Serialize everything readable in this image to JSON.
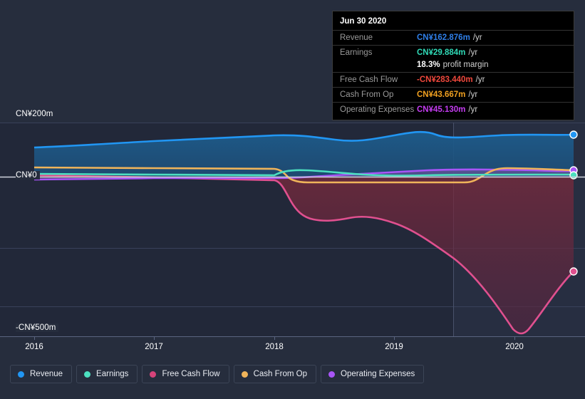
{
  "chart_data": {
    "type": "area",
    "title": "",
    "xlabel": "",
    "ylabel": "",
    "currency": "CN¥",
    "x_tick_labels": [
      "2016",
      "2017",
      "2018",
      "2019",
      "2020"
    ],
    "y_tick_labels": [
      "CN¥200m",
      "CN¥0",
      "-CN¥500m"
    ],
    "ylim": [
      -500,
      200
    ],
    "grid": true,
    "legend_position": "bottom-left",
    "series": [
      {
        "name": "Revenue",
        "color": "#2196f3",
        "x": [
          2016.0,
          2016.5,
          2017.0,
          2017.5,
          2018.0,
          2018.5,
          2019.0,
          2019.25,
          2019.5,
          2020.0,
          2020.5
        ],
        "values": [
          108,
          112,
          118,
          124,
          128,
          130,
          140,
          150,
          152,
          150,
          155
        ]
      },
      {
        "name": "Earnings",
        "color": "#4ce0c0",
        "x": [
          2016.0,
          2016.5,
          2017.0,
          2017.5,
          2018.0,
          2018.5,
          2019.0,
          2019.5,
          2020.0,
          2020.5
        ],
        "values": [
          12,
          12,
          11,
          10,
          24,
          20,
          14,
          14,
          18,
          22
        ]
      },
      {
        "name": "Free Cash Flow",
        "color": "#e0508f",
        "x": [
          2016.0,
          2016.5,
          2017.0,
          2017.5,
          2018.0,
          2018.25,
          2018.5,
          2019.0,
          2019.5,
          2020.0,
          2020.25,
          2020.5
        ],
        "values": [
          8,
          6,
          4,
          2,
          -10,
          -120,
          -150,
          -140,
          -230,
          -420,
          -580,
          -350
        ]
      },
      {
        "name": "Cash From Op",
        "color": "#f0b45a",
        "x": [
          2016.0,
          2016.5,
          2017.0,
          2017.5,
          2018.0,
          2018.25,
          2018.5,
          2019.0,
          2019.5,
          2019.9,
          2020.2,
          2020.5
        ],
        "values": [
          34,
          34,
          33,
          33,
          32,
          5,
          -3,
          -3,
          -3,
          -3,
          20,
          30
        ]
      },
      {
        "name": "Operating Expenses",
        "color": "#a855f7",
        "x": [
          2016.0,
          2016.5,
          2017.0,
          2017.5,
          2018.0,
          2018.5,
          2019.0,
          2019.5,
          2020.0,
          2020.5
        ],
        "values": [
          -10,
          -8,
          -6,
          -4,
          4,
          10,
          18,
          26,
          24,
          22
        ]
      }
    ],
    "endpoint_markers": [
      {
        "series": "Revenue",
        "color": "#2196f3"
      },
      {
        "series": "Operating Expenses",
        "color": "#a855f7"
      },
      {
        "series": "Earnings",
        "color": "#4ce0c0"
      },
      {
        "series": "Free Cash Flow",
        "color": "#e0508f"
      }
    ]
  },
  "axis": {
    "y_200m": "CN¥200m",
    "y_0": "CN¥0",
    "y_minus500m": "-CN¥500m",
    "x": [
      {
        "label": "2016"
      },
      {
        "label": "2017"
      },
      {
        "label": "2018"
      },
      {
        "label": "2019"
      },
      {
        "label": "2020"
      }
    ]
  },
  "tooltip": {
    "date": "Jun 30 2020",
    "rows": [
      {
        "label": "Revenue",
        "value": "CN¥162.876m",
        "unit": "/yr",
        "color": "#2f7fe8"
      },
      {
        "label": "Earnings",
        "value": "CN¥29.884m",
        "unit": "/yr",
        "color": "#2fd9b6"
      },
      {
        "label": "",
        "value": "18.3%",
        "unit": "profit margin",
        "color": "#ffffff"
      },
      {
        "label": "Free Cash Flow",
        "value": "-CN¥283.440m",
        "unit": "/yr",
        "color": "#f0483c"
      },
      {
        "label": "Cash From Op",
        "value": "CN¥43.667m",
        "unit": "/yr",
        "color": "#f0a020"
      },
      {
        "label": "Operating Expenses",
        "value": "CN¥45.130m",
        "unit": "/yr",
        "color": "#c43cf0"
      }
    ]
  },
  "legend": {
    "items": [
      {
        "label": "Revenue",
        "color": "#2196f3"
      },
      {
        "label": "Earnings",
        "color": "#4ce0c0"
      },
      {
        "label": "Free Cash Flow",
        "color": "#d6437a"
      },
      {
        "label": "Cash From Op",
        "color": "#f0b45a"
      },
      {
        "label": "Operating Expenses",
        "color": "#a855f7"
      }
    ]
  }
}
